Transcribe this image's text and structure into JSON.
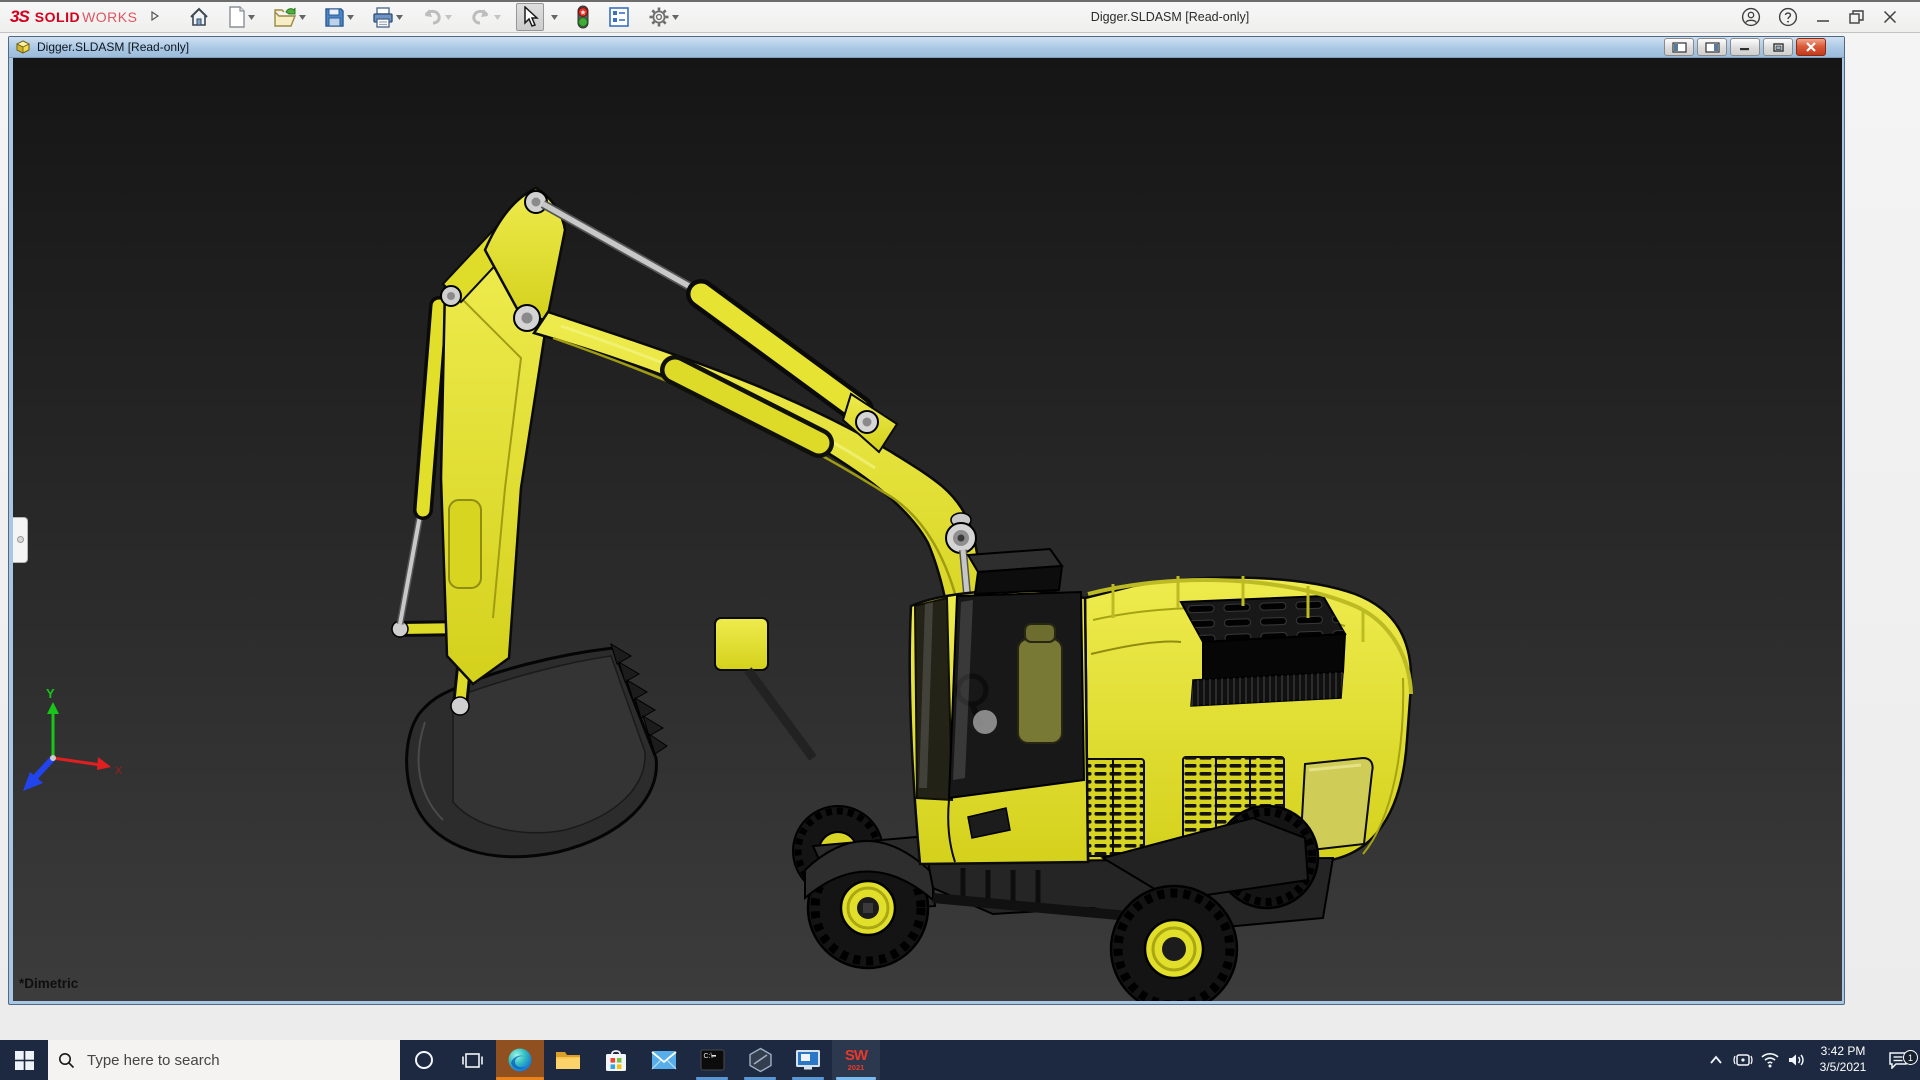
{
  "titlebar": {
    "brand": {
      "prefix": "3S",
      "bold": "SOLID",
      "light": "WORKS"
    },
    "title": "Digger.SLDASM [Read-only]",
    "window_controls": [
      "user-account",
      "help",
      "minimize",
      "restore-down",
      "close"
    ]
  },
  "toolbar": {
    "items": [
      {
        "name": "home",
        "enabled": true,
        "dropdown": false
      },
      {
        "name": "new-document",
        "enabled": true,
        "dropdown": true
      },
      {
        "name": "open",
        "enabled": true,
        "dropdown": true
      },
      {
        "name": "save",
        "enabled": true,
        "dropdown": true
      },
      {
        "name": "print",
        "enabled": true,
        "dropdown": true
      },
      {
        "name": "undo",
        "enabled": false,
        "dropdown": true
      },
      {
        "name": "redo",
        "enabled": false,
        "dropdown": true
      },
      {
        "name": "select",
        "enabled": true,
        "dropdown": true,
        "pressed": true
      },
      {
        "name": "rebuild",
        "enabled": true,
        "dropdown": false
      },
      {
        "name": "file-properties",
        "enabled": true,
        "dropdown": false
      },
      {
        "name": "options",
        "enabled": true,
        "dropdown": true
      }
    ]
  },
  "document_window": {
    "title": "Digger.SLDASM [Read-only]",
    "controls": [
      "pane-left",
      "pane-right",
      "minimize",
      "restore",
      "close"
    ]
  },
  "viewport": {
    "view_label": "*Dimetric",
    "triad": {
      "x": "X",
      "y": "Y"
    },
    "colors": {
      "background_top": "#151515",
      "background_bottom": "#3c3c3c",
      "model_yellow": "#e4e12c",
      "window_border_blue": "#a9c7e4"
    }
  },
  "taskbar": {
    "search": {
      "placeholder": "Type here to search"
    },
    "cmd_text": "C:\\",
    "solidworks_badge": {
      "top": "SW",
      "year": "2021"
    },
    "apps": [
      "edge",
      "file-explorer",
      "store",
      "mail",
      "command-prompt",
      "hexagon-tool",
      "remote-desktop",
      "solidworks-2021"
    ],
    "running_apps": [
      "command-prompt",
      "hexagon-tool",
      "remote-desktop",
      "solidworks-2021"
    ],
    "tray": {
      "time": "3:42 PM",
      "date": "3/5/2021",
      "notification_count": "1"
    },
    "colors": {
      "taskbar_bg": "#1d2940",
      "edge_highlight_bg": "#91501f",
      "edge_underline": "#e8821a",
      "running_underline": "#5a96cf",
      "active_underline": "#79bbee"
    }
  }
}
